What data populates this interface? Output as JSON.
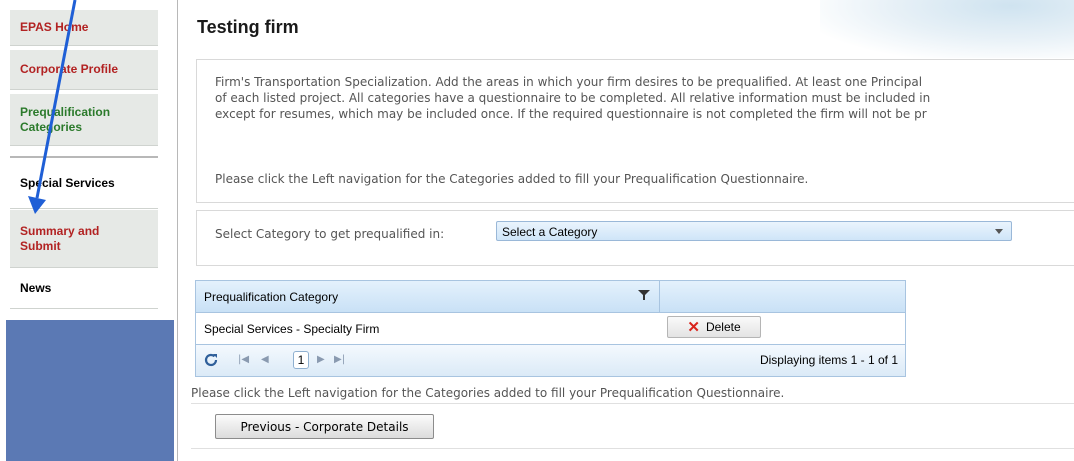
{
  "sidebar": {
    "items": [
      {
        "label": "EPAS Home"
      },
      {
        "label": "Corporate Profile"
      },
      {
        "label": "Prequalification Categories"
      },
      {
        "label": "Special Services"
      },
      {
        "label": "Summary and Submit"
      },
      {
        "label": "News"
      }
    ]
  },
  "page": {
    "title": "Testing firm"
  },
  "info": {
    "text": "Firm's Transportation Specialization. Add the areas in which your firm desires to be prequalified. At least one Principal\nof each listed project. All categories have a questionnaire to be completed. All relative information must be included in\nexcept for resumes, which may be included once. If the required questionnaire is not completed the firm will not be pr",
    "note": "Please click the Left navigation for the Categories added to fill your Prequalification Questionnaire."
  },
  "category_select": {
    "label": "Select Category to get prequalified in:",
    "value": "Select a Category"
  },
  "grid": {
    "header": "Prequalification Category",
    "rows": [
      {
        "category": "Special Services - Specialty Firm",
        "action": "Delete"
      }
    ],
    "pager": {
      "current_page": "1",
      "info": "Displaying items 1 - 1 of 1"
    }
  },
  "bottom": {
    "note": "Please click the Left navigation for the Categories added to fill your Prequalification Questionnaire.",
    "previous_button": "Previous - Corporate Details"
  },
  "colors": {
    "nav_red": "#b22222",
    "nav_green": "#2b7a2b",
    "sidebar_block": "#5b79b4",
    "arrow": "#1f5fd6",
    "delete_icon": "#d9241c"
  }
}
